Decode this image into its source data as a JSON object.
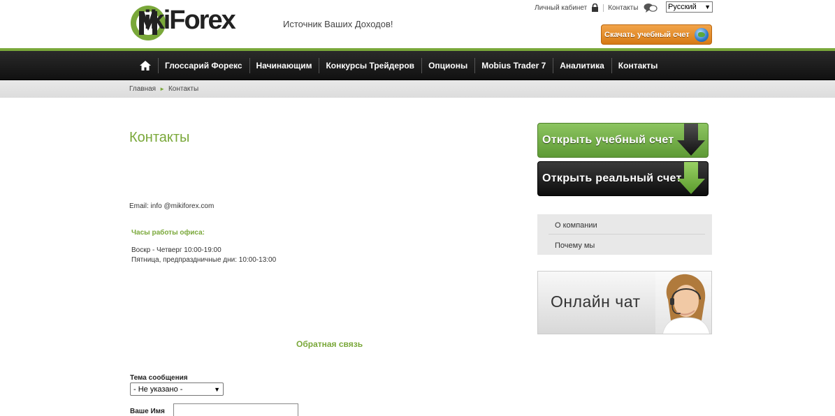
{
  "header": {
    "logo_text": "ikiForex",
    "tagline": "Источник Ваших Доходов!",
    "account_link": "Личный кабинет",
    "contacts_link": "Контакты",
    "language": "Русский",
    "download_button": "Скачать учебный счет"
  },
  "nav": {
    "items": [
      "Глоссарий Форекс",
      "Начинающим",
      "Конкурсы Трейдеров",
      "Опционы",
      "Mobius Trader 7",
      "Аналитика",
      "Контакты"
    ]
  },
  "breadcrumb": {
    "home": "Главная",
    "current": "Контакты"
  },
  "main": {
    "title": "Контакты",
    "email": "Email: info @mikiforex.com",
    "hours_title": "Часы работы офиса:",
    "hours_line1": "Воскр - Четверг  10:00-19:00",
    "hours_line2": "Пятница, предпраздничные дни:  10:00-13:00",
    "feedback_title": "Обратная связь",
    "subject_label": "Тема сообщения",
    "subject_value": "- Не указано -",
    "name_label": "Ваше Имя",
    "name_value": ""
  },
  "sidebar": {
    "open_demo": "Открыть учебный счет",
    "open_real": "Открыть реальный счет",
    "menu": [
      "О компании",
      "Почему мы"
    ],
    "chat": "Онлайн чат"
  },
  "colors": {
    "accent_green": "#7aa83a",
    "nav_dark": "#1b1b1b",
    "download_orange": "#e08a22"
  }
}
